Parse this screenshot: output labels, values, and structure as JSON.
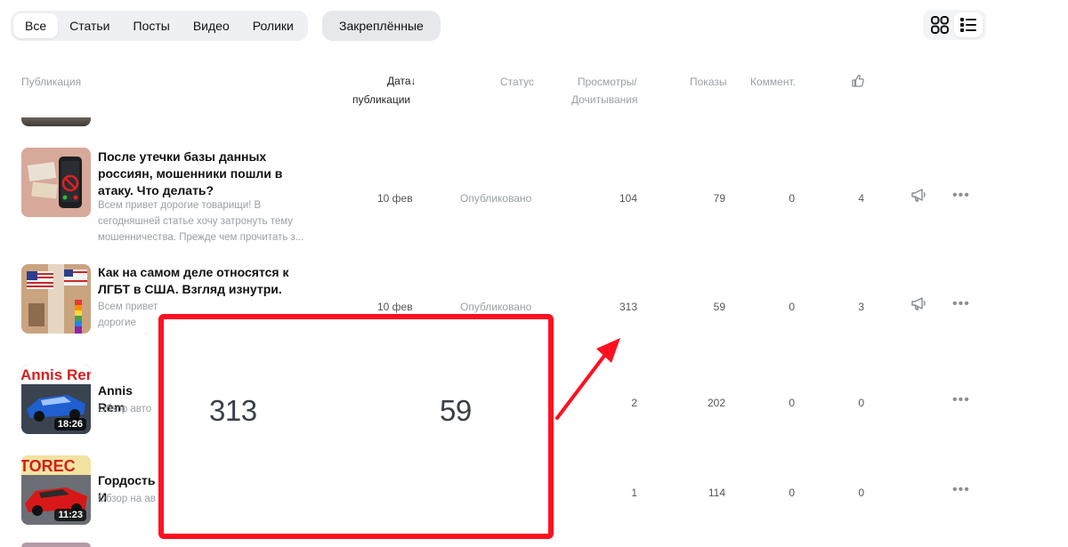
{
  "tabs": [
    {
      "label": "Все",
      "active": true
    },
    {
      "label": "Статьи",
      "active": false
    },
    {
      "label": "Посты",
      "active": false
    },
    {
      "label": "Видео",
      "active": false
    },
    {
      "label": "Ролики",
      "active": false
    }
  ],
  "pinned_label": "Закреплённые",
  "columns": {
    "publication": "Публикация",
    "date_line1": "Дата",
    "date_arrow": "↓",
    "date_line2": "публикации",
    "status": "Статус",
    "views_line1": "Просмотры/",
    "views_line2": "Дочитывания",
    "impressions": "Показы",
    "comments": "Коммент."
  },
  "rows": [
    {
      "title": "После утечки базы данных россиян, мошенники пошли в атаку. Что делать?",
      "desc": "Всем привет дорогие товарищи! В сегодняшней статье хочу затронуть тему мошенничества. Прежде чем прочитать з...",
      "date": "10 фев",
      "status": "Опубликовано",
      "views": "104",
      "impressions": "79",
      "comments": "0",
      "likes": "4"
    },
    {
      "title": "Как на самом деле относятся к ЛГБТ в США. Взгляд изнутри.",
      "desc": "Всем привет дорогие товарищи! Все мы знаем, что з пропаганди",
      "date": "10 фев",
      "status": "Опубликовано",
      "views": "313",
      "impressions": "59",
      "comments": "0",
      "likes": "3"
    },
    {
      "title": "Annis Rem",
      "desc": "Обзор авто",
      "duration": "18:26",
      "thumb_text": "Annis Rem",
      "views": "2",
      "impressions": "202",
      "comments": "0",
      "likes": "0"
    },
    {
      "title": "Гордость И",
      "desc": "Обзор на ав",
      "duration": "11:23",
      "thumb_text": "TOREC",
      "views": "1",
      "impressions": "114",
      "comments": "0",
      "likes": "0"
    }
  ],
  "zoom": {
    "views": "313",
    "impressions": "59"
  },
  "colors": {
    "highlight": "#ff1020",
    "tab_bg": "#eef0f3"
  }
}
